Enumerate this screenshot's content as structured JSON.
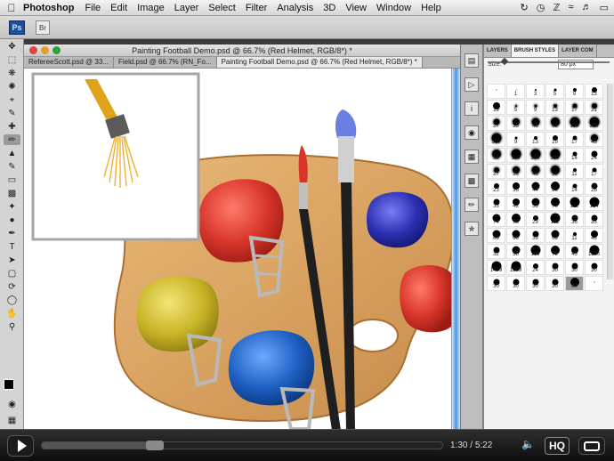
{
  "menubar": {
    "app_name": "Photoshop",
    "items": [
      "File",
      "Edit",
      "Image",
      "Layer",
      "Select",
      "Filter",
      "Analysis",
      "3D",
      "View",
      "Window",
      "Help"
    ]
  },
  "appbar": {
    "ps_logo": "Ps",
    "bridge": "Br"
  },
  "document": {
    "title": "Painting Football Demo.psd @ 66.7% (Red Helmet, RGB/8*) *",
    "tabs": [
      {
        "label": "RefereeScott.psd @ 33..."
      },
      {
        "label": "Field.psd @ 66.7% (RN_Fo..."
      },
      {
        "label": "Painting Football Demo.psd @ 66.7% (Red Helmet, RGB/8*) *"
      }
    ]
  },
  "panel": {
    "tabs": [
      "LAYERS",
      "BRUSH STYLES",
      "LAYER COM"
    ],
    "size_label": "Size:",
    "size_value": "80 px",
    "size_level": 0.12,
    "brushes": [
      {
        "l": "",
        "s": 1
      },
      {
        "l": "1",
        "s": 1
      },
      {
        "l": "3",
        "s": 2
      },
      {
        "l": "5",
        "s": 3
      },
      {
        "l": "9",
        "s": 4
      },
      {
        "l": "13",
        "s": 6
      },
      {
        "l": "19",
        "s": 8
      },
      {
        "l": "5",
        "s": 2,
        "soft": true
      },
      {
        "l": "9",
        "s": 3,
        "soft": true
      },
      {
        "l": "13",
        "s": 4,
        "soft": true
      },
      {
        "l": "17",
        "s": 5,
        "soft": true
      },
      {
        "l": "21",
        "s": 6,
        "soft": true
      },
      {
        "l": "27",
        "s": 7,
        "soft": true
      },
      {
        "l": "35",
        "s": 8,
        "soft": true
      },
      {
        "l": "45",
        "s": 9,
        "soft": true
      },
      {
        "l": "65",
        "s": 10,
        "soft": true
      },
      {
        "l": "100",
        "s": 11,
        "soft": true
      },
      {
        "l": "200",
        "s": 11,
        "soft": true
      },
      {
        "l": "300",
        "s": 11,
        "soft": true
      },
      {
        "l": "9",
        "s": 3
      },
      {
        "l": "13",
        "s": 4
      },
      {
        "l": "19",
        "s": 6
      },
      {
        "l": "17",
        "s": 5
      },
      {
        "l": "45",
        "s": 8,
        "soft": true
      },
      {
        "l": "65",
        "s": 10,
        "soft": true
      },
      {
        "l": "100",
        "s": 11,
        "soft": true
      },
      {
        "l": "200",
        "s": 11,
        "soft": true
      },
      {
        "l": "300",
        "s": 11,
        "soft": true
      },
      {
        "l": "14",
        "s": 5
      },
      {
        "l": "24",
        "s": 7
      },
      {
        "l": "27",
        "s": 6,
        "soft": true
      },
      {
        "l": "39",
        "s": 8,
        "soft": true
      },
      {
        "l": "46",
        "s": 9,
        "soft": true
      },
      {
        "l": "59",
        "s": 10,
        "soft": true
      },
      {
        "l": "11",
        "s": 4
      },
      {
        "l": "17",
        "s": 5
      },
      {
        "l": "23",
        "s": 6
      },
      {
        "l": "36",
        "s": 8
      },
      {
        "l": "44",
        "s": 9
      },
      {
        "l": "60",
        "s": 10
      },
      {
        "l": "14",
        "s": 5
      },
      {
        "l": "26",
        "s": 7
      },
      {
        "l": "33",
        "s": 7
      },
      {
        "l": "42",
        "s": 8
      },
      {
        "l": "55",
        "s": 9
      },
      {
        "l": "70",
        "s": 10
      },
      {
        "l": "112",
        "s": 11
      },
      {
        "l": "134",
        "s": 11
      },
      {
        "l": "74",
        "s": 9
      },
      {
        "l": "95",
        "s": 10
      },
      {
        "l": "29",
        "s": 6
      },
      {
        "l": "192",
        "s": 11
      },
      {
        "l": "36",
        "s": 7
      },
      {
        "l": "33",
        "s": 7
      },
      {
        "l": "63",
        "s": 9
      },
      {
        "l": "66",
        "s": 9
      },
      {
        "l": "39",
        "s": 7
      },
      {
        "l": "63",
        "s": 9
      },
      {
        "l": "11",
        "s": 4
      },
      {
        "l": "48",
        "s": 8
      },
      {
        "l": "32",
        "s": 7
      },
      {
        "l": "55",
        "s": 9
      },
      {
        "l": "100",
        "s": 11
      },
      {
        "l": "75",
        "s": 10
      },
      {
        "l": "45",
        "s": 8
      },
      {
        "l": "1106",
        "s": 11
      },
      {
        "l": "1499",
        "s": 11
      },
      {
        "l": "1569",
        "s": 11
      },
      {
        "l": "24",
        "s": 6
      },
      {
        "l": "30",
        "s": 7
      },
      {
        "l": "30",
        "s": 7
      },
      {
        "l": "30",
        "s": 7
      },
      {
        "l": "30",
        "s": 7
      },
      {
        "l": "30",
        "s": 7
      },
      {
        "l": "30",
        "s": 7
      },
      {
        "l": "30",
        "s": 7
      },
      {
        "l": "80",
        "s": 10
      },
      {
        "l": "",
        "s": 1
      }
    ]
  },
  "video": {
    "time_current": "1:30",
    "time_sep": " / ",
    "time_total": "5:22",
    "progress": 0.28,
    "hq_label": "HQ"
  },
  "colors": {
    "palette_wood": "#d9a261",
    "helmet_red": "#d8352a",
    "helmet_yellow": "#c9b427",
    "helmet_blue": "#1d5fc2",
    "paint_purple": "#2a2fb0",
    "scrollbar_blue": "#4a96e0"
  }
}
